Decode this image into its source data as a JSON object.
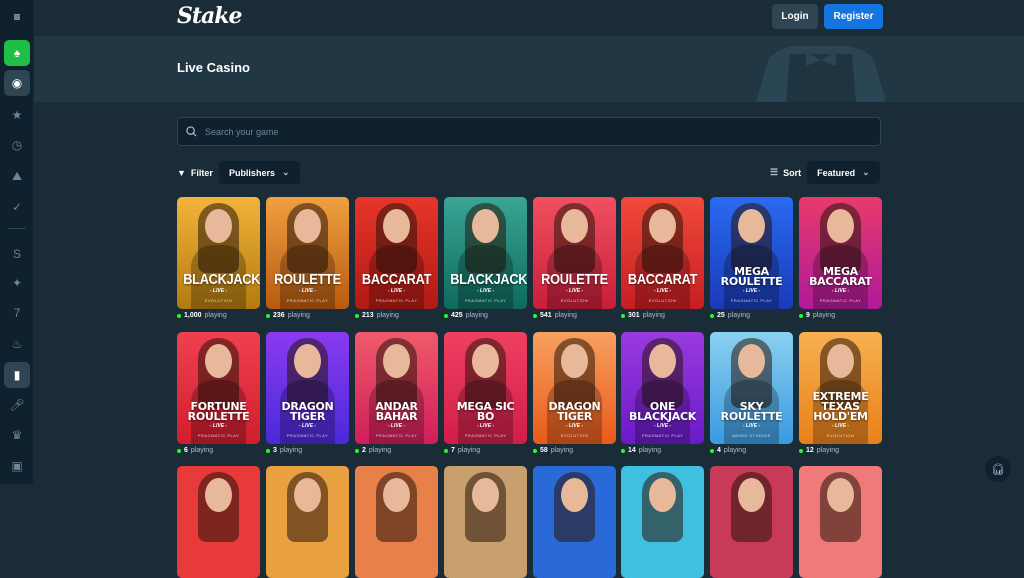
{
  "sidebar": {
    "items": [
      {
        "icon": "menu-icon"
      },
      {
        "icon": "casino-icon"
      },
      {
        "icon": "sports-icon"
      },
      {
        "icon": "star-icon"
      },
      {
        "icon": "clock-icon"
      },
      {
        "icon": "trophy-icon"
      },
      {
        "icon": "ticket-icon"
      },
      {
        "icon": "stake-originals-icon"
      },
      {
        "icon": "sparkle-icon"
      },
      {
        "icon": "slots-icon"
      },
      {
        "icon": "fire-icon"
      },
      {
        "icon": "live-dealer-icon"
      },
      {
        "icon": "microphone-icon"
      },
      {
        "icon": "crown-icon"
      },
      {
        "icon": "gift-icon"
      }
    ]
  },
  "header": {
    "logo": "Stake",
    "login": "Login",
    "register": "Register"
  },
  "banner": {
    "title": "Live Casino"
  },
  "search": {
    "placeholder": "Search your game"
  },
  "filter": {
    "label": "Filter",
    "publishers": "Publishers",
    "sort_label": "Sort",
    "sort_value": "Featured"
  },
  "colors": {
    "accent": "#1475e1",
    "green": "#1fbf45",
    "bg": "#1a2c38"
  },
  "games": [
    {
      "title": "BLACKJACK",
      "live": "- LIVE -",
      "provider": "EVOLUTION",
      "players": "1,000",
      "suffix": "playing",
      "bg": "linear-gradient(#f3b43a,#b27a10)"
    },
    {
      "title": "ROULETTE",
      "live": "- LIVE -",
      "provider": "PRAGMATIC PLAY",
      "players": "236",
      "suffix": "playing",
      "bg": "linear-gradient(#f0a040,#b85a10)"
    },
    {
      "title": "BACCARAT",
      "live": "- LIVE -",
      "provider": "PRAGMATIC PLAY",
      "players": "213",
      "suffix": "playing",
      "bg": "linear-gradient(#e8352a,#b01a14)"
    },
    {
      "title": "BLACKJACK",
      "live": "- LIVE -",
      "provider": "PRAGMATIC PLAY",
      "players": "425",
      "suffix": "playing",
      "bg": "linear-gradient(#3aa596,#0e6a5c)"
    },
    {
      "title": "ROULETTE",
      "live": "- LIVE -",
      "provider": "EVOLUTION",
      "players": "541",
      "suffix": "playing",
      "bg": "linear-gradient(#f05060,#c81e3a)"
    },
    {
      "title": "BACCARAT",
      "live": "- LIVE -",
      "provider": "EVOLUTION",
      "players": "301",
      "suffix": "playing",
      "bg": "linear-gradient(#f04a3a,#c81e24)"
    },
    {
      "title": "MEGA ROULETTE",
      "live": "- LIVE -",
      "provider": "PRAGMATIC PLAY",
      "players": "25",
      "suffix": "playing",
      "bg": "linear-gradient(#2a6af0,#1a3ab8)"
    },
    {
      "title": "MEGA BACCARAT",
      "live": "- LIVE -",
      "provider": "PRAGMATIC PLAY",
      "players": "9",
      "suffix": "playing",
      "bg": "linear-gradient(#e83a6a,#b01a9a)"
    },
    {
      "title": "FORTUNE ROULETTE",
      "live": "- LIVE -",
      "provider": "PRAGMATIC PLAY",
      "players": "6",
      "suffix": "playing",
      "bg": "linear-gradient(#f04050,#d01e2e)"
    },
    {
      "title": "DRAGON TIGER",
      "live": "- LIVE -",
      "provider": "PRAGMATIC PLAY",
      "players": "3",
      "suffix": "playing",
      "bg": "linear-gradient(#8a3af0,#4a2ad8)"
    },
    {
      "title": "ANDAR BAHAR",
      "live": "- LIVE -",
      "provider": "PRAGMATIC PLAY",
      "players": "2",
      "suffix": "playing",
      "bg": "linear-gradient(#f05a6a,#d01e5a)"
    },
    {
      "title": "MEGA SIC BO",
      "live": "- LIVE -",
      "provider": "PRAGMATIC PLAY",
      "players": "7",
      "suffix": "playing",
      "bg": "linear-gradient(#f04060,#d01e4a)"
    },
    {
      "title": "DRAGON TIGER",
      "live": "- LIVE -",
      "provider": "EVOLUTION",
      "players": "58",
      "suffix": "playing",
      "bg": "linear-gradient(#f8a060,#e85a1a)"
    },
    {
      "title": "ONE BLACKJACK",
      "live": "- LIVE -",
      "provider": "PRAGMATIC PLAY",
      "players": "14",
      "suffix": "playing",
      "bg": "linear-gradient(#9a3ae0,#6a1ac8)"
    },
    {
      "title": "SKY ROULETTE",
      "live": "- LIVE -",
      "provider": "ANIMO STUDIOS",
      "players": "4",
      "suffix": "playing",
      "bg": "linear-gradient(#8ad0f0,#3a9ae0)"
    },
    {
      "title": "EXTREME TEXAS HOLD'EM",
      "live": "- LIVE -",
      "provider": "EVOLUTION",
      "players": "12",
      "suffix": "playing",
      "bg": "linear-gradient(#f8b050,#e8801a)"
    }
  ],
  "row3": [
    "#e83a3a",
    "#e8a040",
    "#e8804a",
    "#c8a070",
    "#2a6ad8",
    "#40c0e0",
    "#c83a5a",
    "#f07a7a"
  ]
}
